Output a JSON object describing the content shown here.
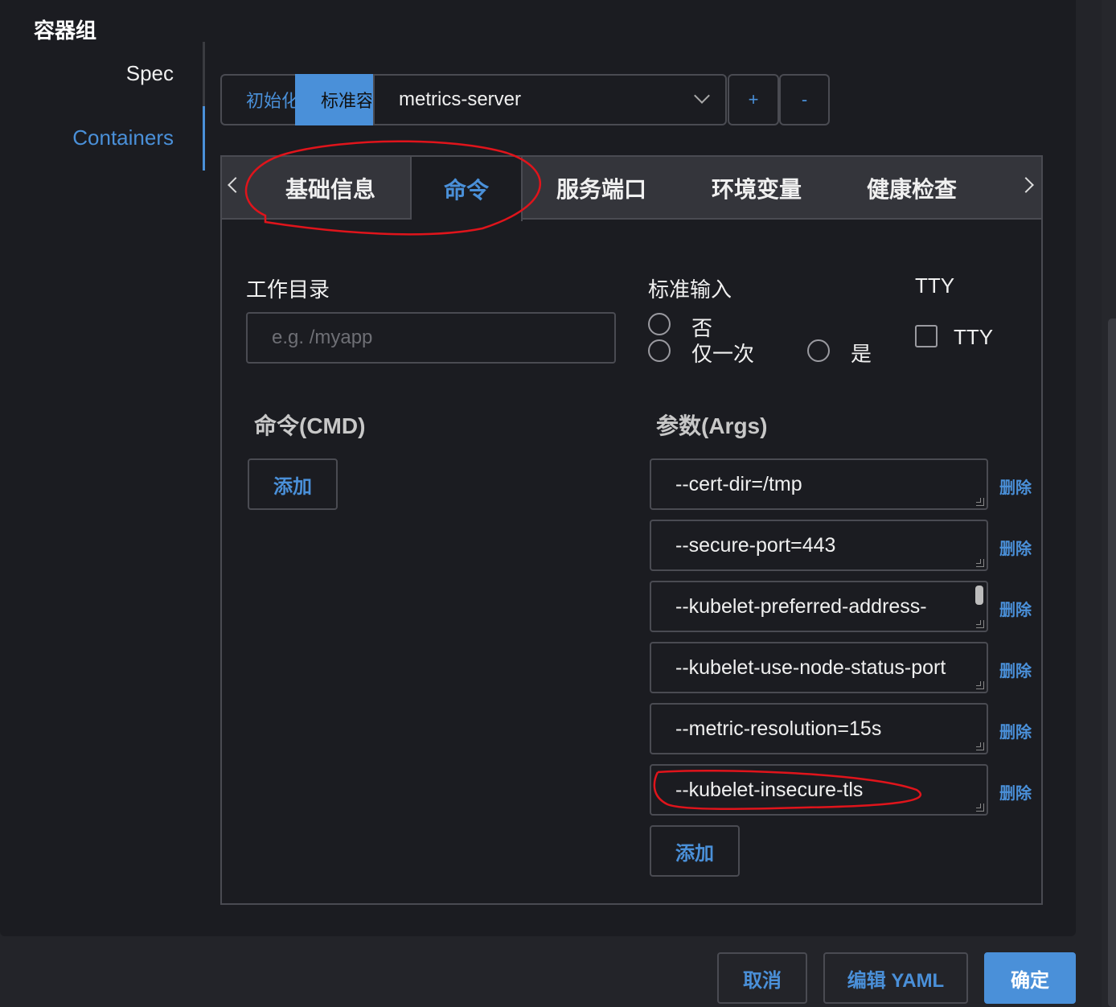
{
  "section_title": "容器组",
  "sidebar": {
    "items": [
      {
        "label": "Spec"
      },
      {
        "label": "Containers"
      }
    ]
  },
  "container_switch": {
    "init_label": "初始化",
    "standard_label": "标准容器",
    "selected_container": "metrics-server",
    "add_label": "+",
    "remove_label": "-"
  },
  "tabs": [
    {
      "label": "基础信息"
    },
    {
      "label": "命令"
    },
    {
      "label": "服务端口"
    },
    {
      "label": "环境变量"
    },
    {
      "label": "健康检查"
    }
  ],
  "command_tab": {
    "workdir_label": "工作目录",
    "workdir_placeholder": "e.g. /myapp",
    "stdin_label": "标准输入",
    "stdin_options": [
      "否",
      "仅一次",
      "是"
    ],
    "tty_title": "TTY",
    "tty_checkbox_label": "TTY",
    "cmd_label": "命令(CMD)",
    "cmd_add_label": "添加",
    "args_label": "参数(Args)",
    "args": [
      "--cert-dir=/tmp",
      "--secure-port=443",
      "--kubelet-preferred-address-",
      "--kubelet-use-node-status-port",
      "--metric-resolution=15s",
      "--kubelet-insecure-tls"
    ],
    "delete_label": "删除",
    "args_add_label": "添加"
  },
  "footer": {
    "cancel": "取消",
    "edit_yaml": "编辑 YAML",
    "confirm": "确定"
  },
  "colors": {
    "accent": "#4a90d9",
    "annotation": "#e0141b",
    "background": "#1b1c21"
  }
}
